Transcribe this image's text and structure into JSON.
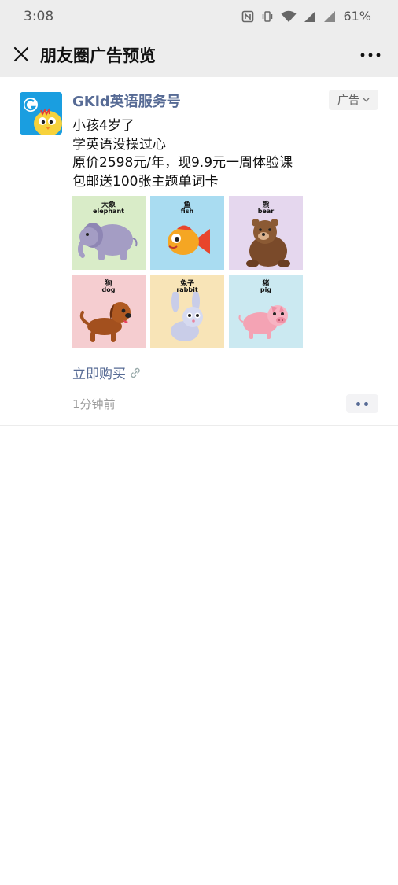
{
  "status_bar": {
    "time": "3:08",
    "battery": "61%"
  },
  "header": {
    "title": "朋友圈广告预览"
  },
  "post": {
    "author": "GKid英语服务号",
    "ad_label": "广告",
    "lines": [
      "小孩4岁了",
      "学英语没操过心",
      "原价2598元/年，现9.9元一周体验课",
      "包邮送100张主题单词卡"
    ],
    "images": [
      {
        "cn": "大象",
        "en": "elephant",
        "bg": "#d9ecc8"
      },
      {
        "cn": "鱼",
        "en": "fish",
        "bg": "#a9dcf1"
      },
      {
        "cn": "熊",
        "en": "bear",
        "bg": "#e5d7ee"
      },
      {
        "cn": "狗",
        "en": "dog",
        "bg": "#f5cdd0"
      },
      {
        "cn": "兔子",
        "en": "rabbit",
        "bg": "#f8e4b7"
      },
      {
        "cn": "猪",
        "en": "pig",
        "bg": "#cbe9f1"
      }
    ],
    "buy_link": "立即购买",
    "time_ago": "1分钟前"
  },
  "colors": {
    "link": "#576b95",
    "bar_bg": "#ededed"
  }
}
